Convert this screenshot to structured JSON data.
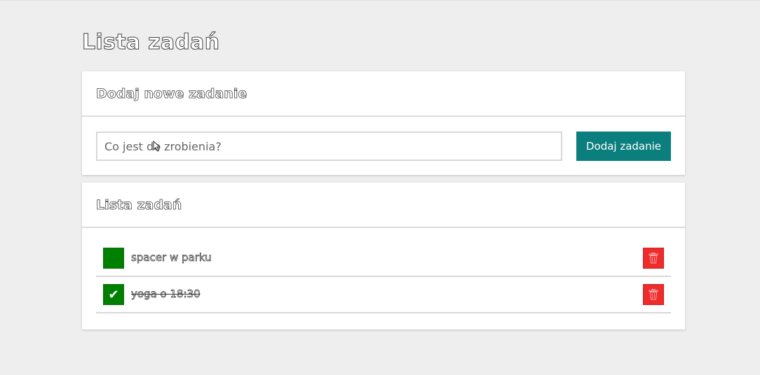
{
  "page_title": "Lista zadań",
  "add_card": {
    "header": "Dodaj nowe zadanie",
    "input_placeholder": "Co jest do zrobienia?",
    "input_value": "",
    "button_label": "Dodaj zadanie"
  },
  "list_card": {
    "header": "Lista zadań",
    "tasks": [
      {
        "text": "spacer w parku",
        "done": false,
        "check_glyph": ""
      },
      {
        "text": "yoga o 18:30",
        "done": true,
        "check_glyph": "✔"
      }
    ]
  },
  "colors": {
    "background": "#eeeeee",
    "accent_teal": "#0b7f7d",
    "checkbox_green": "#008000",
    "delete_red": "#ee2c2c"
  },
  "icons": {
    "delete": "trash-icon",
    "check": "checkmark-icon",
    "cursor": "mouse-pointer-icon"
  }
}
